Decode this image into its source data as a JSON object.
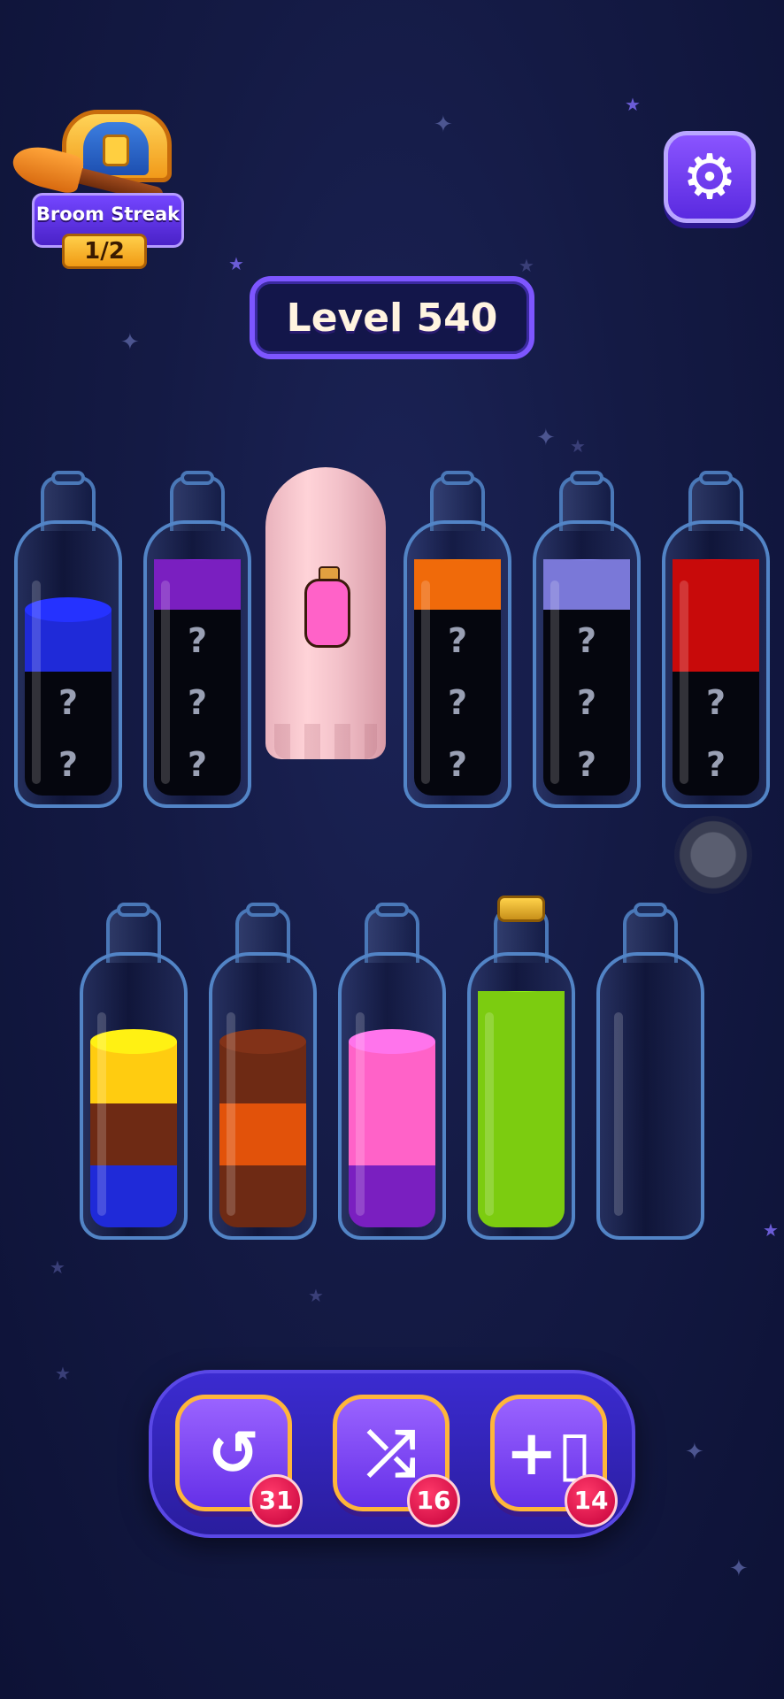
{
  "streak": {
    "label": "Broom Streak",
    "count": "1/2"
  },
  "level": {
    "label": "Level 540"
  },
  "settings_icon": "gear-icon",
  "colors": {
    "blue": "#1f2ad8",
    "purple": "#7a1fc0",
    "orange": "#f06a0a",
    "lavender": "#7a78d8",
    "red": "#c80a0a",
    "yellow": "#ffcc10",
    "brown": "#6e2a14",
    "dark-orange": "#e2520a",
    "pink": "#ff62c8",
    "lime": "#7ccc10",
    "hidden": "#05060e"
  },
  "rows": [
    {
      "bottles": [
        {
          "id": "bottle-1",
          "segments": [
            "hidden",
            "hidden",
            "blue"
          ]
        },
        {
          "id": "bottle-2",
          "segments": [
            "hidden",
            "hidden",
            "hidden",
            "purple"
          ]
        },
        {
          "id": "bottle-3",
          "covered": true,
          "preview_color": "pink"
        },
        {
          "id": "bottle-4",
          "segments": [
            "hidden",
            "hidden",
            "hidden",
            "orange"
          ]
        },
        {
          "id": "bottle-5",
          "segments": [
            "hidden",
            "hidden",
            "hidden",
            "lavender"
          ]
        },
        {
          "id": "bottle-6",
          "segments": [
            "hidden",
            "hidden",
            "red",
            "red"
          ]
        }
      ]
    },
    {
      "bottles": [
        {
          "id": "bottle-7",
          "segments": [
            "blue",
            "brown",
            "yellow"
          ]
        },
        {
          "id": "bottle-8",
          "segments": [
            "brown",
            "dark-orange",
            "brown"
          ]
        },
        {
          "id": "bottle-9",
          "segments": [
            "purple",
            "pink",
            "pink"
          ]
        },
        {
          "id": "bottle-10",
          "segments": [
            "lime",
            "lime",
            "lime",
            "lime"
          ],
          "corked": true
        },
        {
          "id": "bottle-11",
          "segments": []
        }
      ]
    }
  ],
  "hidden_mark": "?",
  "powerups": [
    {
      "name": "undo-button",
      "icon": "undo-icon",
      "glyph": "↺",
      "count": "31"
    },
    {
      "name": "shuffle-button",
      "icon": "shuffle-icon",
      "glyph": "⤮",
      "count": "16"
    },
    {
      "name": "add-bottle-button",
      "icon": "add-bottle-icon",
      "glyph": "+▯",
      "count": "14"
    }
  ]
}
